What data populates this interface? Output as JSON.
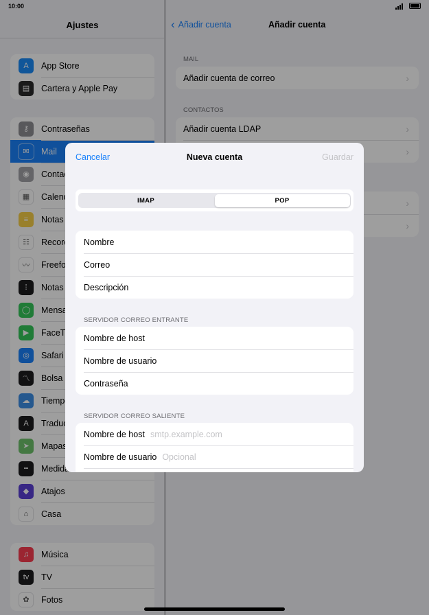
{
  "status": {
    "time": "10:00"
  },
  "sidebar": {
    "title": "Ajustes",
    "groups": [
      [
        {
          "label": "App Store",
          "icon": "app-store-icon",
          "color": "#1a8cf7",
          "glyph": "A"
        },
        {
          "label": "Cartera y Apple Pay",
          "icon": "wallet-icon",
          "color": "#2b2b2b",
          "glyph": "▤"
        }
      ],
      [
        {
          "label": "Contraseñas",
          "icon": "key-icon",
          "color": "#8e8e93",
          "glyph": "⚷"
        },
        {
          "label": "Mail",
          "icon": "mail-icon",
          "color": "#1a82fb",
          "glyph": "✉",
          "selected": true
        },
        {
          "label": "Contactos",
          "icon": "contacts-icon",
          "color": "#a2a2a7",
          "glyph": "◉"
        },
        {
          "label": "Calendario",
          "icon": "calendar-icon",
          "color": "#ffffff",
          "glyph": "▦"
        },
        {
          "label": "Notas",
          "icon": "notes-icon",
          "color": "#f7cf48",
          "glyph": "≡"
        },
        {
          "label": "Recordatorios",
          "icon": "reminders-icon",
          "color": "#ffffff",
          "glyph": "☷"
        },
        {
          "label": "Freeform",
          "icon": "freeform-icon",
          "color": "#ffffff",
          "glyph": "〰"
        },
        {
          "label": "Notas de voz",
          "icon": "voice-memos-icon",
          "color": "#1c1c1e",
          "glyph": "⁞"
        },
        {
          "label": "Mensajes",
          "icon": "messages-icon",
          "color": "#34c759",
          "glyph": "◯"
        },
        {
          "label": "FaceTime",
          "icon": "facetime-icon",
          "color": "#34c759",
          "glyph": "▶"
        },
        {
          "label": "Safari",
          "icon": "safari-icon",
          "color": "#1a82fb",
          "glyph": "◎"
        },
        {
          "label": "Bolsa",
          "icon": "stocks-icon",
          "color": "#1c1c1e",
          "glyph": "〽"
        },
        {
          "label": "Tiempo",
          "icon": "weather-icon",
          "color": "#3c8ee6",
          "glyph": "☁"
        },
        {
          "label": "Traducir",
          "icon": "translate-icon",
          "color": "#1c1c1e",
          "glyph": "A"
        },
        {
          "label": "Mapas",
          "icon": "maps-icon",
          "color": "#6fc26b",
          "glyph": "➤"
        },
        {
          "label": "Medidas",
          "icon": "measure-icon",
          "color": "#1c1c1e",
          "glyph": "┅"
        },
        {
          "label": "Atajos",
          "icon": "shortcuts-icon",
          "color": "#5b3fd6",
          "glyph": "◆"
        },
        {
          "label": "Casa",
          "icon": "home-icon",
          "color": "#ffffff",
          "glyph": "⌂"
        }
      ],
      [
        {
          "label": "Música",
          "icon": "music-icon",
          "color": "#fa3c50",
          "glyph": "♫"
        },
        {
          "label": "TV",
          "icon": "tv-icon",
          "color": "#1c1c1e",
          "glyph": "tv"
        },
        {
          "label": "Fotos",
          "icon": "photos-icon",
          "color": "#ffffff",
          "glyph": "✿"
        }
      ]
    ]
  },
  "detail": {
    "back_label": "Añadir cuenta",
    "title": "Añadir cuenta",
    "sections": [
      {
        "header": "MAIL",
        "rows": [
          "Añadir cuenta de correo"
        ]
      },
      {
        "header": "CONTACTOS",
        "rows": [
          "Añadir cuenta LDAP",
          ""
        ]
      }
    ]
  },
  "modal": {
    "cancel": "Cancelar",
    "title": "Nueva cuenta",
    "save": "Guardar",
    "segments": {
      "left": "IMAP",
      "right": "POP",
      "selected": "POP"
    },
    "basic_fields": [
      "Nombre",
      "Correo",
      "Descripción"
    ],
    "incoming": {
      "header": "SERVIDOR CORREO ENTRANTE",
      "fields": [
        "Nombre de host",
        "Nombre de usuario",
        "Contraseña"
      ]
    },
    "outgoing": {
      "header": "SERVIDOR CORREO SALIENTE",
      "fields": [
        {
          "label": "Nombre de host",
          "placeholder": "smtp.example.com"
        },
        {
          "label": "Nombre de usuario",
          "placeholder": "Opcional"
        }
      ]
    }
  }
}
